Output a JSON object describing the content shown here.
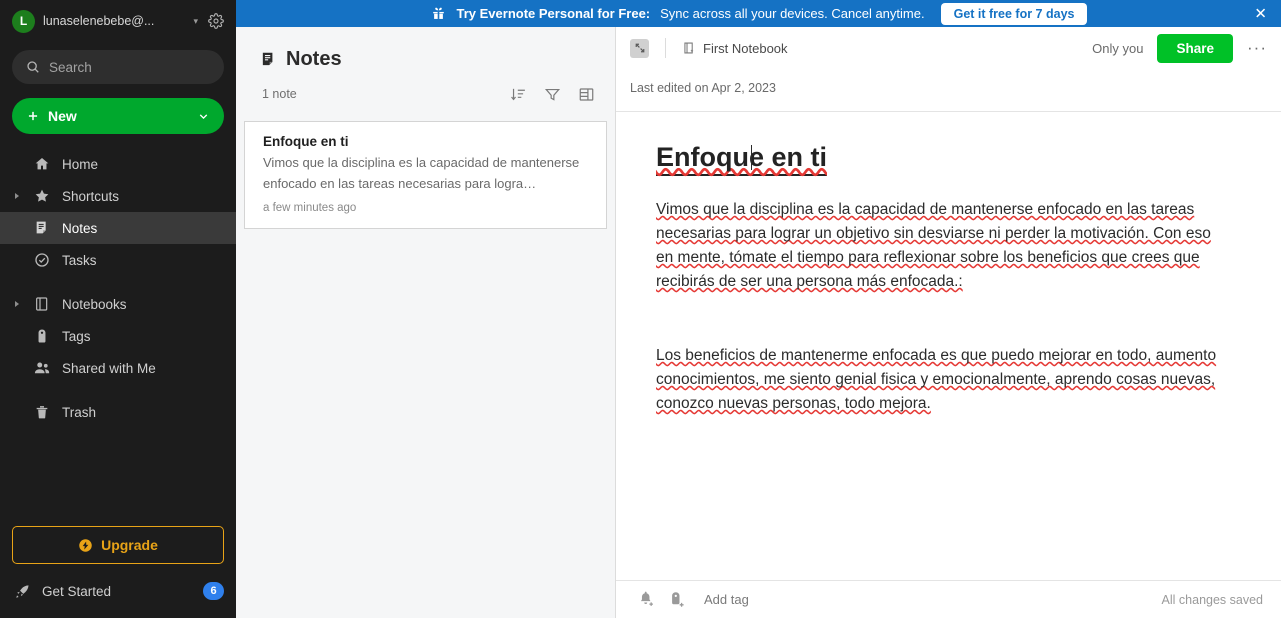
{
  "banner": {
    "icon": "gift-icon",
    "headline": "Try Evernote Personal for Free:",
    "subtext": "Sync across all your devices. Cancel anytime.",
    "cta_label": "Get it free for 7 days",
    "close_label": "✕",
    "bg_color": "#1572c4"
  },
  "sidebar": {
    "account": {
      "avatar_initial": "L",
      "email": "lunaselenebebe@...",
      "chevron": "▾",
      "settings_icon": "gear-icon"
    },
    "search": {
      "placeholder": "Search",
      "icon": "search-icon"
    },
    "new_button": {
      "label": "New",
      "plus": "+",
      "chevron": "▾",
      "color": "#00a82d"
    },
    "items": [
      {
        "label": "Home",
        "icon": "home-icon",
        "twisty": false,
        "active": false
      },
      {
        "label": "Shortcuts",
        "icon": "star-icon",
        "twisty": true,
        "active": false
      },
      {
        "label": "Notes",
        "icon": "notes-icon",
        "twisty": false,
        "active": true
      },
      {
        "label": "Tasks",
        "icon": "check-circle-icon",
        "twisty": false,
        "active": false
      },
      {
        "label": "Notebooks",
        "icon": "notebook-icon",
        "twisty": true,
        "active": false
      },
      {
        "label": "Tags",
        "icon": "tag-icon",
        "twisty": false,
        "active": false
      },
      {
        "label": "Shared with Me",
        "icon": "people-icon",
        "twisty": false,
        "active": false
      },
      {
        "label": "Trash",
        "icon": "trash-icon",
        "twisty": false,
        "active": false
      }
    ],
    "upgrade": {
      "label": "Upgrade",
      "icon": "bolt-icon",
      "color": "#e8a317"
    },
    "get_started": {
      "label": "Get Started",
      "icon": "rocket-icon",
      "badge": "6",
      "badge_color": "#2f80ed"
    }
  },
  "notelist": {
    "title": "Notes",
    "title_icon": "notes-icon",
    "count_label": "1 note",
    "tools": [
      {
        "name": "sort-icon",
        "label": "Sort"
      },
      {
        "name": "filter-icon",
        "label": "Filter"
      },
      {
        "name": "view-layout-icon",
        "label": "View options"
      }
    ],
    "notes": [
      {
        "title": "Enfoque en ti",
        "snippet": "Vimos que la disciplina es la capacidad de mantenerse enfocado en las tareas necesarias para logra…",
        "time": "a few minutes ago",
        "selected": true
      }
    ]
  },
  "editor": {
    "expand_icon": "expand-icon",
    "notebook": {
      "label": "First Notebook",
      "icon": "notebook-small-icon"
    },
    "only_you": "Only you",
    "share_label": "Share",
    "share_color": "#00c127",
    "more_label": "···",
    "last_edited": "Last edited on Apr 2, 2023",
    "note_title": "Enfoque en ti",
    "paragraphs": [
      "Vimos que la disciplina es la capacidad de mantenerse enfocado en las tareas necesarias para lograr un objetivo sin desviarse ni perder la motivación. Con eso en mente, tómate el tiempo para reflexionar sobre los beneficios que crees que recibirás de ser una persona más enfocada.:",
      "Los beneficios de mantenerme enfocada es que puedo mejorar en todo, aumento conocimientos, me siento genial fisica y emocionalmente, aprendo cosas nuevas, conozco nuevas personas, todo mejora."
    ],
    "footer": {
      "reminder_icon": "bell-plus-icon",
      "tag_icon": "tag-plus-icon",
      "add_tag_label": "Add tag",
      "status": "All changes saved"
    }
  }
}
